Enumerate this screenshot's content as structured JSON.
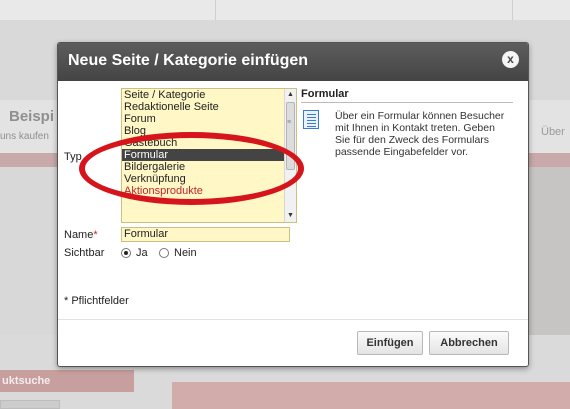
{
  "background": {
    "heading_fragment": "Beispi",
    "subtext_fragment": "uns kaufen",
    "right_fragment": "Über",
    "sidebar_label": "uktsuche"
  },
  "dialog": {
    "title": "Neue Seite / Kategorie einfügen",
    "close_icon": "x",
    "type_label": "Typ",
    "type_options": [
      "Seite / Kategorie",
      "Redaktionelle Seite",
      "Forum",
      "Blog",
      "Gästebuch",
      "Formular",
      "Bildergalerie",
      "Verknüpfung",
      "Aktionsprodukte"
    ],
    "selected_type": "Formular",
    "description": {
      "title": "Formular",
      "icon": "form-document-icon",
      "text": "Über ein Formular können Besucher mit Ihnen in Kontakt treten. Geben Sie für den Zweck des Formulars passende Eingabefelder vor."
    },
    "name_label": "Name",
    "required_mark": "*",
    "name_value": "Formular",
    "visible_label": "Sichtbar",
    "visible_options": [
      "Ja",
      "Nein"
    ],
    "visible_selected": "Ja",
    "required_note": "* Pflichtfelder",
    "insert_button": "Einfügen",
    "cancel_button": "Abbrechen"
  },
  "colors": {
    "titlebar": "#4f4f4f",
    "field_background": "#fff7c6",
    "selection": "#444444",
    "highlight_ellipse": "#d6141b"
  }
}
